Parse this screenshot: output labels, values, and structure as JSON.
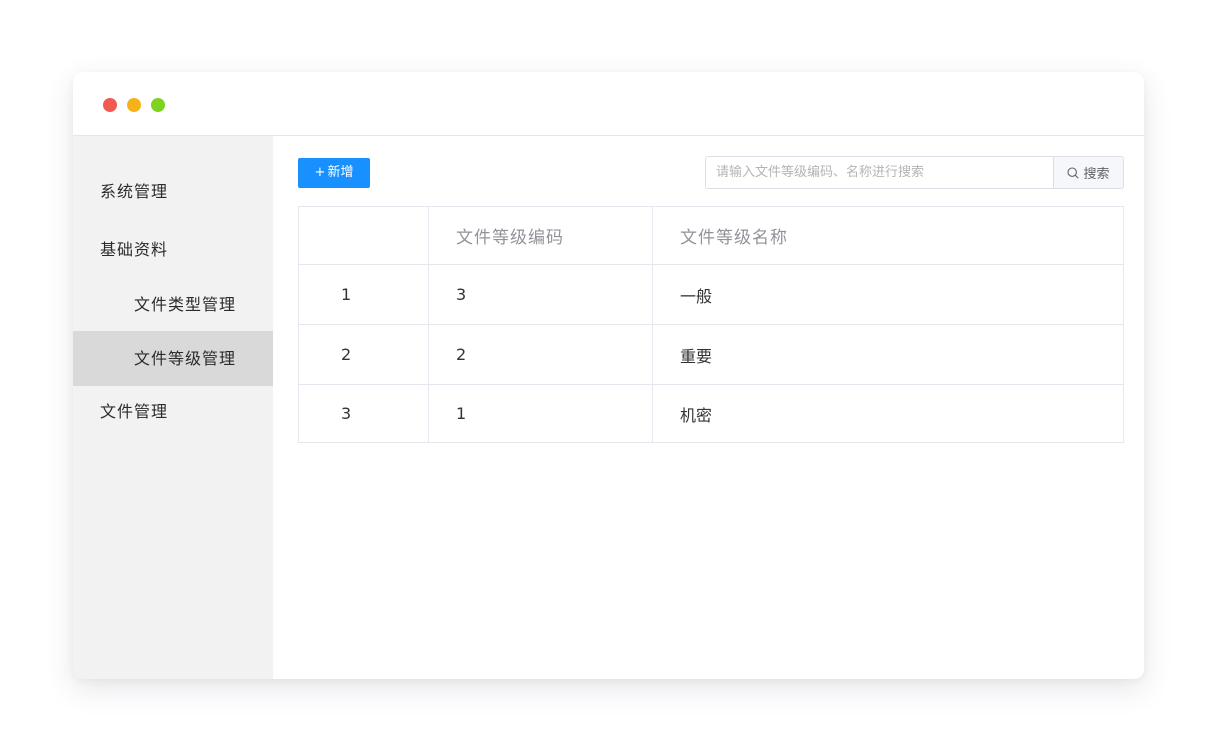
{
  "window": {
    "controls": {
      "close_color": "#f05a4f",
      "minimize_color": "#f5b21b",
      "maximize_color": "#7ed321"
    }
  },
  "sidebar": {
    "items": [
      {
        "label": "系统管理",
        "level": 1,
        "active": false
      },
      {
        "label": "基础资料",
        "level": 1,
        "active": false
      },
      {
        "label": "文件类型管理",
        "level": 2,
        "active": false
      },
      {
        "label": "文件等级管理",
        "level": 2,
        "active": true
      },
      {
        "label": "文件管理",
        "level": 1,
        "active": false
      }
    ]
  },
  "toolbar": {
    "add_plus": "+",
    "add_label": "新增",
    "add_color": "#1890ff",
    "search_placeholder": "请输入文件等级编码、名称进行搜索",
    "search_value": "",
    "search_label": "搜索",
    "search_icon": "search-icon"
  },
  "table": {
    "columns": [
      "",
      "文件等级编码",
      "文件等级名称"
    ],
    "rows": [
      {
        "index": "1",
        "code": "3",
        "name": "一般"
      },
      {
        "index": "2",
        "code": "2",
        "name": "重要"
      },
      {
        "index": "3",
        "code": "1",
        "name": "机密"
      }
    ]
  }
}
